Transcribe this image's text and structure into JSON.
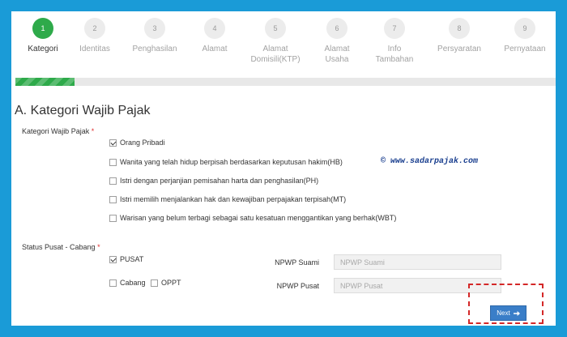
{
  "steps": [
    {
      "number": "1",
      "label": "Kategori",
      "active": true
    },
    {
      "number": "2",
      "label": "Identitas"
    },
    {
      "number": "3",
      "label": "Penghasilan"
    },
    {
      "number": "4",
      "label": "Alamat"
    },
    {
      "number": "5",
      "label": "Alamat Domisili(KTP)"
    },
    {
      "number": "6",
      "label": "Alamat Usaha"
    },
    {
      "number": "7",
      "label": "Info Tambahan"
    },
    {
      "number": "8",
      "label": "Persyaratan"
    },
    {
      "number": "9",
      "label": "Pernyataan"
    }
  ],
  "progress": {
    "fraction": 0.11
  },
  "section": {
    "title": "A. Kategori Wajib Pajak"
  },
  "kategori": {
    "label": "Kategori Wajib Pajak",
    "required_mark": "*",
    "options": [
      {
        "label": "Orang Pribadi",
        "checked": true
      },
      {
        "label": "Wanita yang telah hidup berpisah berdasarkan keputusan hakim(HB)",
        "checked": false
      },
      {
        "label": "Istri dengan perjanjian pemisahan harta dan penghasilan(PH)",
        "checked": false
      },
      {
        "label": "Istri memilih menjalankan hak dan kewajiban perpajakan terpisah(MT)",
        "checked": false
      },
      {
        "label": "Warisan yang belum terbagi sebagai satu kesatuan menggantikan yang berhak(WBT)",
        "checked": false
      }
    ]
  },
  "watermark": {
    "text": "© www.sadarpajak.com"
  },
  "status": {
    "label": "Status Pusat - Cabang",
    "required_mark": "*",
    "options": [
      {
        "label": "PUSAT",
        "checked": true
      },
      {
        "label": "Cabang",
        "checked": false
      },
      {
        "label": "OPPT",
        "checked": false
      }
    ]
  },
  "npwp_suami": {
    "label": "NPWP Suami",
    "placeholder": "NPWP Suami",
    "value": ""
  },
  "npwp_pusat": {
    "label": "NPWP Pusat",
    "placeholder": "NPWP Pusat",
    "value": ""
  },
  "next_button": {
    "label": "Next",
    "icon": "arrow-right-icon"
  },
  "colors": {
    "accent": "#2eaa4a",
    "frame": "#1a9bd7",
    "button": "#3a7ec8",
    "highlight": "#d42828"
  }
}
